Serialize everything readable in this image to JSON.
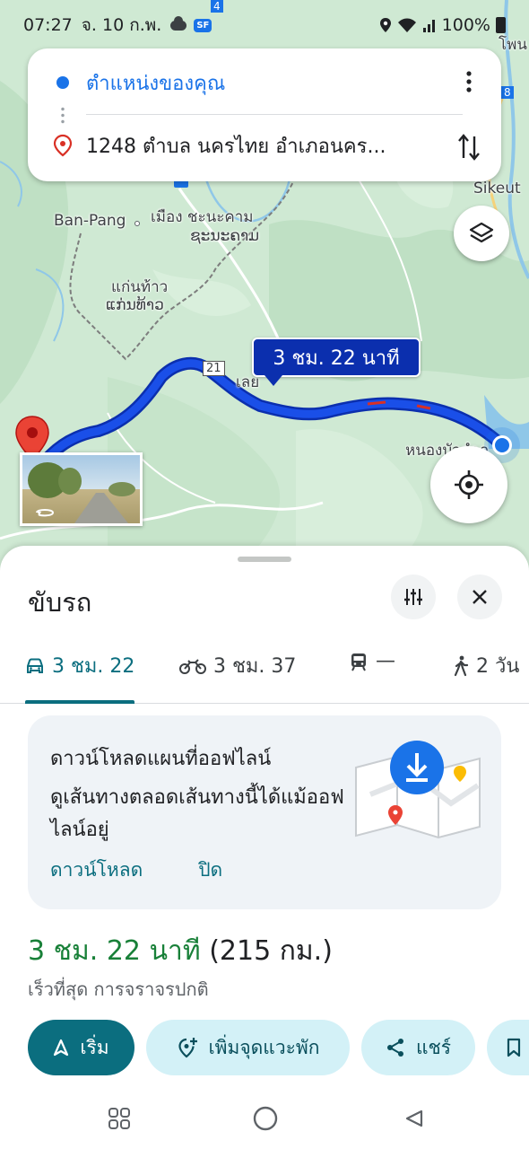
{
  "status_bar": {
    "time": "07:27",
    "date": "จ. 10 ก.พ.",
    "badge": "SF",
    "battery": "100%"
  },
  "search": {
    "origin": "ตำแหน่งของคุณ",
    "destination": "1248 ตำบล นครไทย อำเภอนคร..."
  },
  "map": {
    "labels": {
      "ban_pang": "Ban-Pang",
      "mueang_1": "เมือง ชะนะคาม",
      "mueang_2": "ຊະນະຄາມ",
      "kaen_1": "แก่นท้าว",
      "kaen_2": "ແກ່ນທ້າວ",
      "sikeut": "Sikeut",
      "loei": "เลย",
      "nong": "หนองบัวลำภู",
      "phon": "โพน",
      "road_21": "21",
      "road_4": "4",
      "road_8": "8"
    },
    "route_badge": "3 ชม. 22 นาที",
    "route_color": "#1a4fe8"
  },
  "sheet": {
    "title": "ขับรถ",
    "tabs": [
      {
        "label": "3 ชม. 22",
        "icon": "car-icon"
      },
      {
        "label": "3 ชม. 37",
        "icon": "motorcycle-icon"
      },
      {
        "label": "—",
        "icon": "transit-icon"
      },
      {
        "label": "2 วัน",
        "icon": "walk-icon"
      }
    ],
    "offline": {
      "title": "ดาวน์โหลดแผนที่ออฟไลน์",
      "description": "ดูเส้นทางตลอดเส้นทางนี้ได้แม้ออฟไลน์อยู่",
      "download": "ดาวน์โหลด",
      "close": "ปิด"
    },
    "duration": "3 ชม. 22 นาที",
    "distance": "(215 กม.)",
    "subtitle": "เร็วที่สุด การจราจรปกติ",
    "actions": {
      "start": "เริ่ม",
      "add_stop": "เพิ่มจุดแวะพัก",
      "share": "แชร์"
    }
  },
  "colors": {
    "accent": "#0b6e7f",
    "blue": "#1a73e8",
    "green": "#188038",
    "badge_bg": "#0b2fae"
  }
}
